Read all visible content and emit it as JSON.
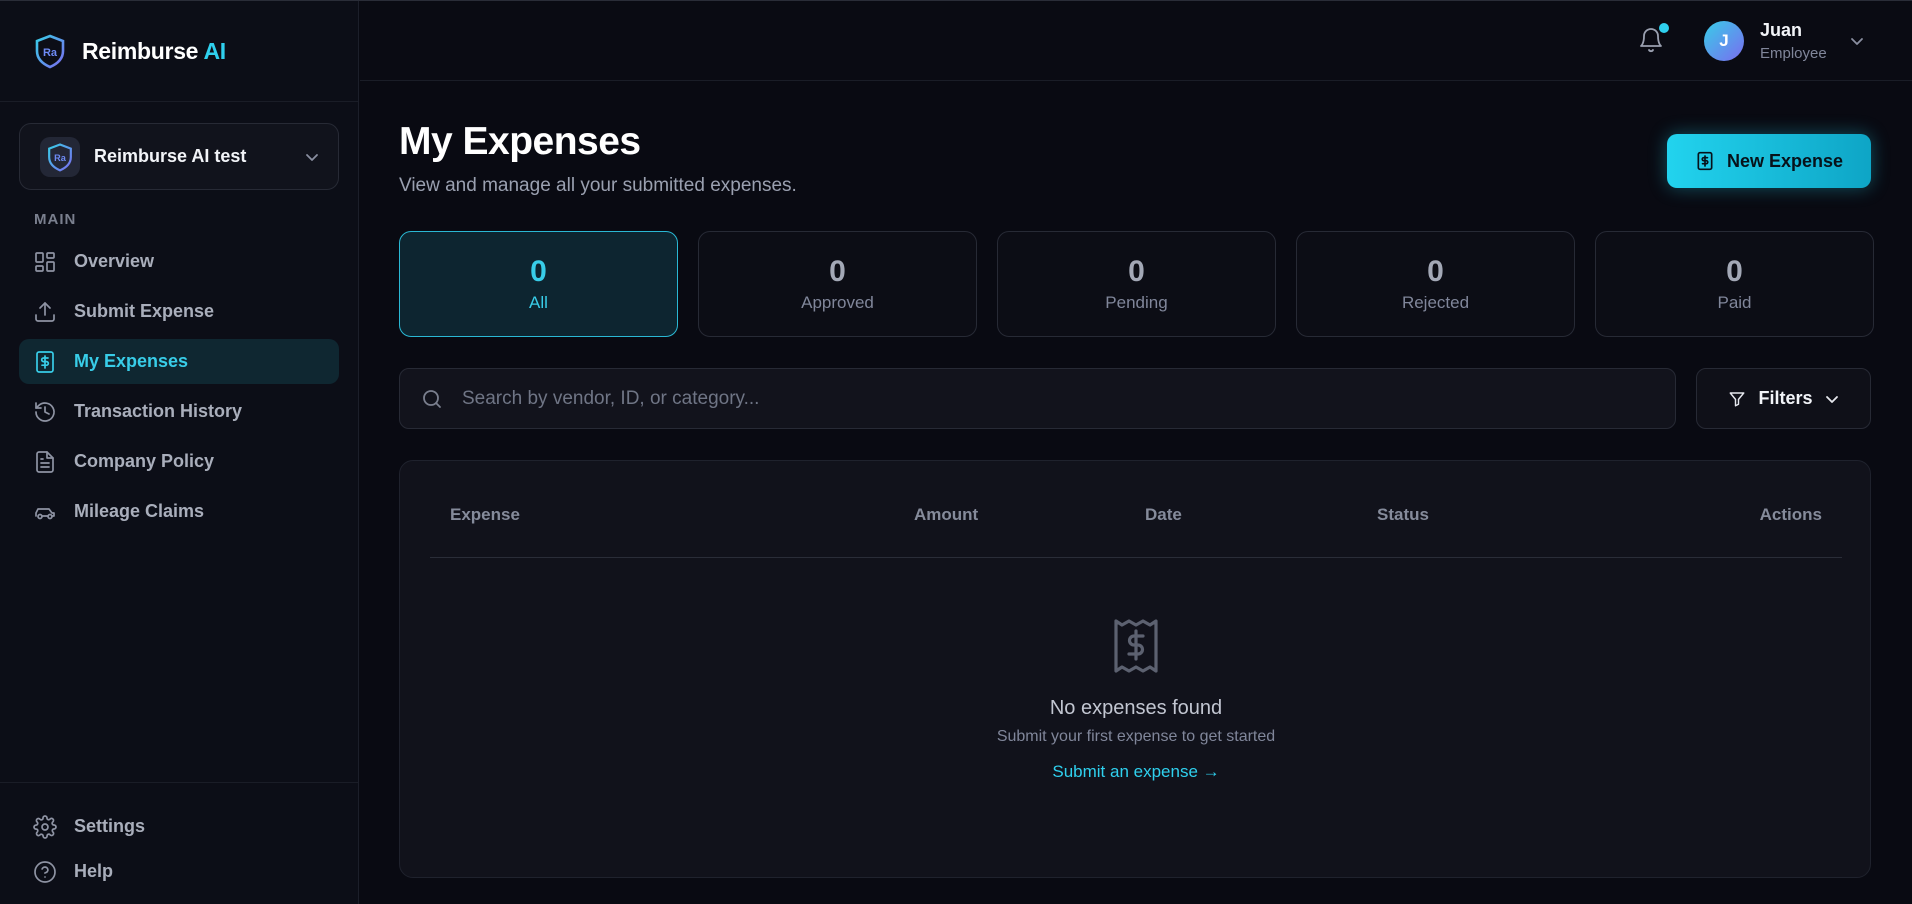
{
  "brand": {
    "name": "Reimburse",
    "name_accent": "AI"
  },
  "org_switcher": {
    "name": "Reimburse AI test"
  },
  "sidebar": {
    "section_label": "MAIN",
    "items": [
      {
        "label": "Overview",
        "icon": "grid-icon"
      },
      {
        "label": "Submit Expense",
        "icon": "upload-icon"
      },
      {
        "label": "My Expenses",
        "icon": "dollar-receipt-icon",
        "active": true
      },
      {
        "label": "Transaction History",
        "icon": "history-icon"
      },
      {
        "label": "Company Policy",
        "icon": "document-icon"
      },
      {
        "label": "Mileage Claims",
        "icon": "car-icon"
      }
    ],
    "bottom": [
      {
        "label": "Settings",
        "icon": "gear-icon"
      },
      {
        "label": "Help",
        "icon": "help-circle-icon"
      }
    ]
  },
  "header": {
    "user": {
      "initial": "J",
      "name": "Juan",
      "role": "Employee"
    },
    "has_notification": true
  },
  "page": {
    "title": "My Expenses",
    "subtitle": "View and manage all your submitted expenses.",
    "new_button": "New Expense"
  },
  "stats": [
    {
      "count": "0",
      "label": "All",
      "active": true
    },
    {
      "count": "0",
      "label": "Approved"
    },
    {
      "count": "0",
      "label": "Pending"
    },
    {
      "count": "0",
      "label": "Rejected"
    },
    {
      "count": "0",
      "label": "Paid"
    }
  ],
  "search": {
    "placeholder": "Search by vendor, ID, or category..."
  },
  "filters": {
    "label": "Filters"
  },
  "table": {
    "columns": [
      "Expense",
      "Amount",
      "Date",
      "Status",
      "Actions"
    ],
    "rows": []
  },
  "empty_state": {
    "title": "No expenses found",
    "subtitle": "Submit your first expense to get started",
    "link": "Submit an expense →"
  },
  "colors": {
    "accent": "#22d3ee",
    "background": "#090a12",
    "sidebar": "#0c0e17"
  }
}
